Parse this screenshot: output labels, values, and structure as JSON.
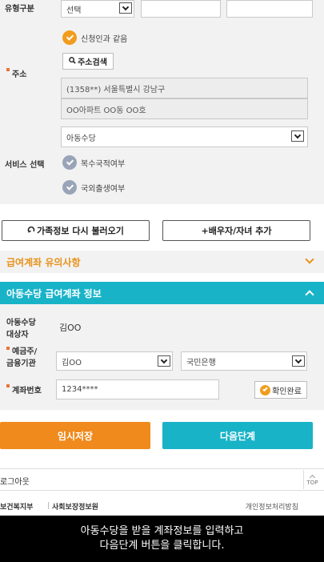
{
  "form": {
    "select_placeholder": "선택",
    "same_as_applicant": "신청인과 같음",
    "address_label": "주소",
    "address_search_btn": "주소검색",
    "address_line1": "(1358**) 서울특별시 강남구",
    "address_line2": "OO아파트 OO동 OO호",
    "service_select_value": "아동수당",
    "service_label": "서비스 선택",
    "option_multi_nationality": "복수국적여부",
    "option_foreign_birth": "국외출생여부"
  },
  "actions": {
    "reload_family": "가족정보 다시 불러오기",
    "add_spouse_child": "+배우자/자녀 추가"
  },
  "notice": {
    "title": "급여계좌 유의사항"
  },
  "account_section": {
    "title": "아동수당 급여계좌 정보",
    "beneficiary_label": "아동수당\n대상자",
    "beneficiary_value": "김OO",
    "holder_label": "예금주/\n금융기관",
    "holder_value": "김OO",
    "bank_value": "국민은행",
    "account_label": "계좌번호",
    "account_value": "1234****",
    "verify_label": "확인완료"
  },
  "buttons": {
    "temp_save": "임시저장",
    "next_step": "다음단계"
  },
  "footer": {
    "logout": "로그아웃",
    "top": "TOP",
    "ministry": "보건복지부",
    "ssis": "사회보장정보원",
    "privacy": "개인정보처리방침"
  },
  "caption": {
    "line1": "아동수당을 받을 계좌정보를 입력하고",
    "line2": "다음단계 버튼을 클릭합니다."
  },
  "colors": {
    "accent_orange": "#f29c1f",
    "teal": "#19b3c8",
    "save_orange": "#f08a1c"
  }
}
